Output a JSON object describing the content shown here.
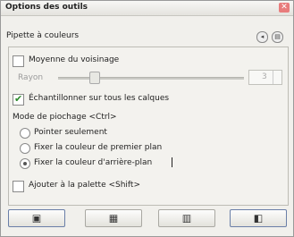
{
  "window": {
    "title": "Options des outils"
  },
  "dock": {
    "title": "Pipette à couleurs"
  },
  "options": {
    "average_label": "Moyenne du voisinage",
    "radius_label": "Rayon",
    "radius_value": "3",
    "sample_merged_label": "Échantillonner sur tous les calques",
    "pick_mode_label": "Mode de piochage <Ctrl>",
    "modes": [
      "Pointer seulement",
      "Fixer la couleur de premier plan",
      "Fixer la couleur d'arrière-plan"
    ],
    "add_palette_label": "Ajouter à la palette <Shift>"
  },
  "buttons": [
    {
      "icon": "save-icon"
    },
    {
      "icon": "restore-icon"
    },
    {
      "icon": "delete-icon"
    },
    {
      "icon": "reset-icon"
    }
  ]
}
